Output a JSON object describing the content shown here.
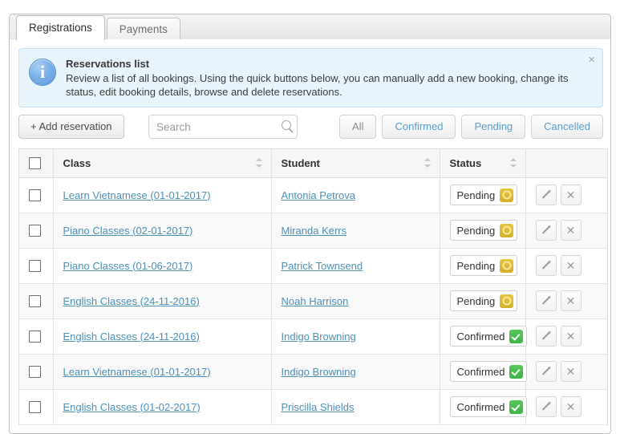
{
  "tabs": [
    {
      "label": "Registrations",
      "active": true
    },
    {
      "label": "Payments",
      "active": false
    }
  ],
  "alert": {
    "icon": "info-icon",
    "title": "Reservations list",
    "text": "Review a list of all bookings. Using the quick buttons below, you can manually add a new booking, change its status, edit booking details, browse and delete reservations.",
    "close_label": "×"
  },
  "toolbar": {
    "add_label": "+ Add reservation",
    "search_placeholder": "Search",
    "search_value": "",
    "search_icon": "search-icon",
    "filters": [
      {
        "label": "All",
        "active": true
      },
      {
        "label": "Confirmed",
        "active": false
      },
      {
        "label": "Pending",
        "active": false
      },
      {
        "label": "Cancelled",
        "active": false
      }
    ]
  },
  "table": {
    "columns": [
      {
        "label": "",
        "sortable": false
      },
      {
        "label": "Class",
        "sortable": true
      },
      {
        "label": "Student",
        "sortable": true
      },
      {
        "label": "Status",
        "sortable": true
      },
      {
        "label": "",
        "sortable": false
      }
    ],
    "rows": [
      {
        "class": "Learn Vietnamese (01-01-2017)",
        "student": "Antonia Petrova",
        "status": "Pending",
        "status_type": "pending"
      },
      {
        "class": "Piano Classes (02-01-2017)",
        "student": "Miranda Kerrs",
        "status": "Pending",
        "status_type": "pending"
      },
      {
        "class": "Piano Classes (01-06-2017)",
        "student": "Patrick Townsend",
        "status": "Pending",
        "status_type": "pending"
      },
      {
        "class": "English Classes (24-11-2016)",
        "student": "Noah Harrison",
        "status": "Pending",
        "status_type": "pending"
      },
      {
        "class": "English Classes (24-11-2016)",
        "student": "Indigo Browning",
        "status": "Confirmed",
        "status_type": "confirmed"
      },
      {
        "class": "Learn Vietnamese (01-01-2017)",
        "student": "Indigo Browning",
        "status": "Confirmed",
        "status_type": "confirmed"
      },
      {
        "class": "English Classes (01-02-2017)",
        "student": "Priscilla Shields",
        "status": "Confirmed",
        "status_type": "confirmed"
      }
    ],
    "actions": {
      "edit_icon": "pencil-icon",
      "delete_icon": "close-icon"
    }
  },
  "colors": {
    "link": "#4d90b8",
    "pending": "#d4b02b",
    "confirmed": "#3fb345",
    "alert_bg": "#e8f4fb",
    "alert_border": "#c5e2f2"
  }
}
